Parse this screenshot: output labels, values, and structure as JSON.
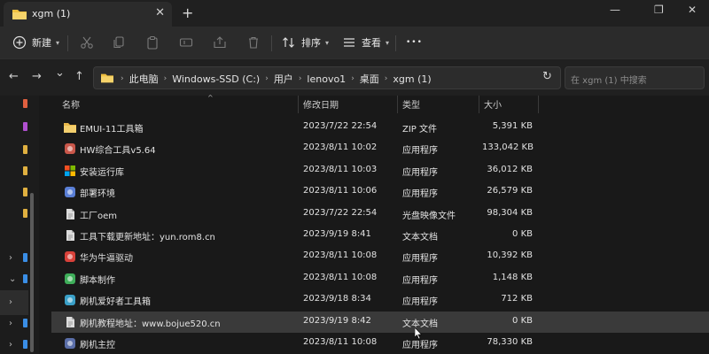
{
  "window": {
    "tab_title": "xgm (1)",
    "close_glyph": "✕",
    "new_tab_glyph": "+",
    "minimize_glyph": "—",
    "maximize_glyph": "❐",
    "close_window_glyph": "✕"
  },
  "commandbar": {
    "new_label": "新建",
    "sort_label": "排序",
    "view_label": "查看",
    "more_glyph": "•••",
    "dropdown_glyph": "▾"
  },
  "nav": {
    "back": "←",
    "forward": "→",
    "recent": "⌄",
    "up": "↑",
    "refresh": "↻"
  },
  "address": {
    "crumbs": [
      "此电脑",
      "Windows-SSD (C:)",
      "用户",
      "lenovo1",
      "桌面",
      "xgm (1)"
    ],
    "separator": "›",
    "dropdown": "⌄"
  },
  "search": {
    "placeholder": "在 xgm (1) 中搜索"
  },
  "columns": {
    "name": "名称",
    "date": "修改日期",
    "type": "类型",
    "size": "大小"
  },
  "sort_caret": "^",
  "files": [
    {
      "name": "EMUI-11工具箱",
      "date": "2023/7/22 22:54",
      "type": "ZIP 文件",
      "size": "5,391 KB",
      "icon": "zip-folder-icon",
      "color": "#e8b84a"
    },
    {
      "name": "HW综合工具v5.64",
      "date": "2023/8/11 10:02",
      "type": "应用程序",
      "size": "133,042 KB",
      "icon": "app-icon",
      "color": "#c9574a"
    },
    {
      "name": "安装运行库",
      "date": "2023/8/11 10:03",
      "type": "应用程序",
      "size": "36,012 KB",
      "icon": "windows-app-icon",
      "color": "#3a8ee6"
    },
    {
      "name": "部署环境",
      "date": "2023/8/11 10:06",
      "type": "应用程序",
      "size": "26,579 KB",
      "icon": "setup-icon",
      "color": "#5a7fd6"
    },
    {
      "name": "工厂oem",
      "date": "2023/7/22 22:54",
      "type": "光盘映像文件",
      "size": "98,304 KB",
      "icon": "disc-image-icon",
      "color": "#dcdcdc"
    },
    {
      "name": "工具下载更新地址：yun.rom8.cn",
      "date": "2023/9/19 8:41",
      "type": "文本文档",
      "size": "0 KB",
      "icon": "text-document-icon",
      "color": "#dcdcdc"
    },
    {
      "name": "华为牛逼驱动",
      "date": "2023/8/11 10:08",
      "type": "应用程序",
      "size": "10,392 KB",
      "icon": "driver-app-icon",
      "color": "#d8413a"
    },
    {
      "name": "脚本制作",
      "date": "2023/8/11 10:08",
      "type": "应用程序",
      "size": "1,148 KB",
      "icon": "script-app-icon",
      "color": "#3fae5a"
    },
    {
      "name": "刷机爱好者工具箱",
      "date": "2023/9/18 8:34",
      "type": "应用程序",
      "size": "712 KB",
      "icon": "toolbox-app-icon",
      "color": "#3aa0c8"
    },
    {
      "name": "刷机教程地址：www.bojue520.cn",
      "date": "2023/9/19 8:42",
      "type": "文本文档",
      "size": "0 KB",
      "icon": "text-document-icon",
      "color": "#dcdcdc"
    },
    {
      "name": "刷机主控",
      "date": "2023/8/11 10:08",
      "type": "应用程序",
      "size": "78,330 KB",
      "icon": "flash-control-app-icon",
      "color": "#5a6ea8"
    }
  ]
}
